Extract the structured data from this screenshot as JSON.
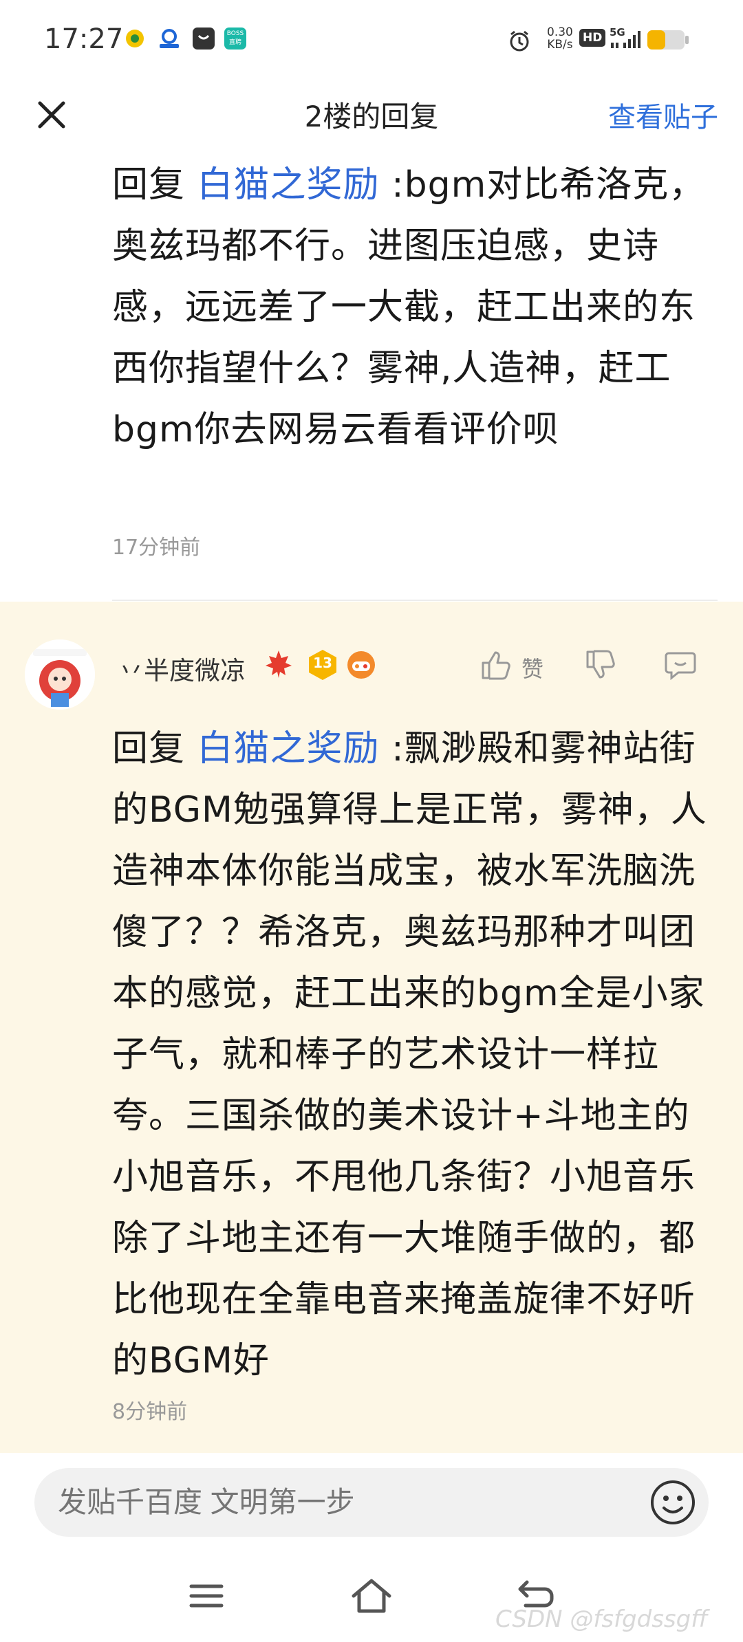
{
  "status_bar": {
    "time": "17:27",
    "speed_value": "0.30",
    "speed_unit": "KB/s",
    "hd": "HD",
    "network": "5G",
    "boss_label_top": "BOSS",
    "boss_label_bottom": "直聘"
  },
  "nav": {
    "title": "2楼的回复",
    "view_post": "查看贴子"
  },
  "reply_1": {
    "prefix": "回复 ",
    "mention": "白猫之奖励",
    "text": "  :bgm对比希洛克，奥兹玛都不行。进图压迫感，史诗感，远远差了一大截，赶工出来的东西你指望什么？雾神,人造神，赶工bgm你去网易云看看评价呗",
    "time": "17分钟前"
  },
  "reply_2": {
    "username": "丷半度微凉",
    "level_badge": "13",
    "like_label": "赞",
    "prefix": "回复 ",
    "mention": "白猫之奖励",
    "text": "  :飘渺殿和雾神站街的BGM勉强算得上是正常，雾神，人造神本体你能当成宝，被水军洗脑洗傻了？？希洛克，奥兹玛那种才叫团本的感觉，赶工出来的bgm全是小家子气，就和棒子的艺术设计一样拉夸。三国杀做的美术设计+斗地主的小旭音乐，不甩他几条街？小旭音乐除了斗地主还有一大堆随手做的，都比他现在全靠电音来掩盖旋律不好听的BGM好",
    "time": "8分钟前"
  },
  "input": {
    "placeholder": "发贴千百度 文明第一步"
  },
  "watermark": "CSDN @fsfgdssgff",
  "colors": {
    "mention": "#3168d5",
    "nav_link": "#2e6fdb",
    "highlight_bg": "#fdf7e6",
    "battery": "#f5b400"
  },
  "icons": [
    "close-icon",
    "like-icon",
    "dislike-icon",
    "reply-icon",
    "emoji-icon",
    "menu-icon",
    "home-icon",
    "back-icon",
    "alarm-icon",
    "signal-icon",
    "battery-icon"
  ]
}
